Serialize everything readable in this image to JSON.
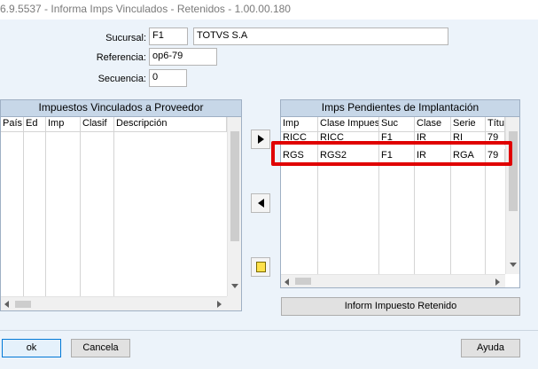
{
  "window": {
    "title": "6.9.5537 - Informa Imps Vinculados - Retenidos - 1.00.00.180"
  },
  "form": {
    "sucursal_label": "Sucursal:",
    "sucursal_code": "F1",
    "sucursal_name": "TOTVS S.A",
    "referencia_label": "Referencia:",
    "referencia_value": "op6-79",
    "secuencia_label": "Secuencia:",
    "secuencia_value": "0"
  },
  "left_panel": {
    "title": "Impuestos Vinculados a Proveedor",
    "columns": [
      "País",
      "Ed",
      "Imp",
      "Clasif",
      "Descripción"
    ]
  },
  "right_panel": {
    "title": "Imps Pendientes de Implantación",
    "columns": [
      "Imp",
      "Clase Impuesto",
      "Suc",
      "Clase",
      "Serie",
      "Título"
    ],
    "rows": [
      [
        "RICC",
        "RICC",
        "F1",
        "IR",
        "RI",
        "79"
      ],
      [
        "RGS",
        "RGS2",
        "F1",
        "IR",
        "RGA",
        "79"
      ]
    ]
  },
  "buttons": {
    "inform": "Inform Impuesto Retenido",
    "ok": "ok",
    "cancel": "Cancela",
    "help": "Ayuda"
  },
  "colors": {
    "highlight": "#e00000",
    "panel_header": "#c7d7e8"
  }
}
